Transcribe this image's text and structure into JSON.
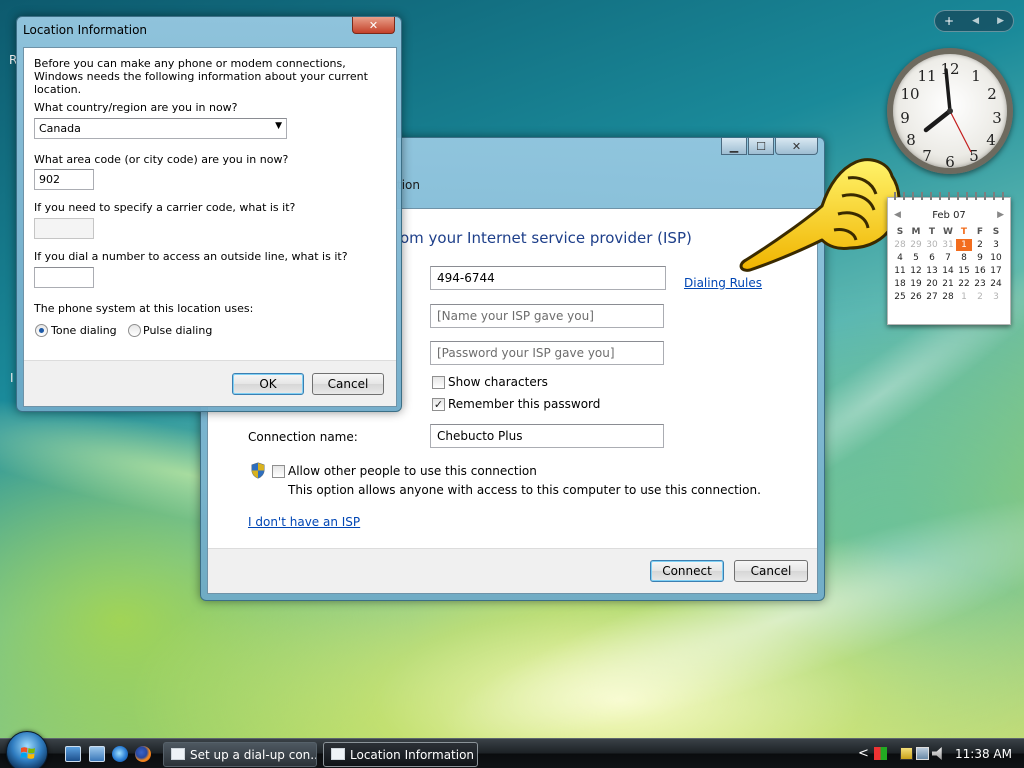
{
  "desktop": {
    "left_letters": [
      "R",
      "I"
    ]
  },
  "dialup_window": {
    "title": "",
    "title_fragment": "tion",
    "header": "om your Internet service provider (ISP)",
    "phone_number": "494-6744",
    "dialing_rules_link": "Dialing Rules",
    "username_placeholder": "[Name your ISP gave you]",
    "password_placeholder": "[Password your ISP gave you]",
    "show_characters": {
      "label": "Show characters",
      "checked": false
    },
    "remember_password": {
      "label": "Remember this password",
      "checked": true
    },
    "connection_name_label": "Connection name:",
    "connection_name": "Chebucto Plus",
    "allow_others": {
      "label": "Allow other people to use this connection",
      "checked": false
    },
    "allow_others_note": "This option allows anyone with access to this computer to use this connection.",
    "no_isp_link": "I don't have an ISP",
    "connect_button": "Connect",
    "cancel_button": "Cancel"
  },
  "location_dialog": {
    "title": "Location Information",
    "intro": "Before you can make any phone or modem connections, Windows needs the following information about your current location.",
    "country_question": "What country/region are you in now?",
    "country_value": "Canada",
    "area_code_question": "What area code (or city code) are you in now?",
    "area_code_value": "902",
    "carrier_question": "If you need to specify a carrier code, what is it?",
    "carrier_value": "",
    "outside_line_question": "If you dial a number to access an outside line, what is it?",
    "outside_line_value": "",
    "phone_system_label": "The phone system at this location uses:",
    "tone_label": "Tone dialing",
    "pulse_label": "Pulse dialing",
    "selected_dialing": "Tone dialing",
    "ok_button": "OK",
    "cancel_button": "Cancel",
    "close_glyph": "✕"
  },
  "gadgets": {
    "bar_buttons": [
      "+",
      "◀",
      "▶"
    ],
    "clock_numbers": [
      "12",
      "1",
      "2",
      "3",
      "4",
      "5",
      "6",
      "7",
      "8",
      "9",
      "10",
      "11"
    ],
    "calendar": {
      "month_label": "Feb 07",
      "day_headers": [
        "S",
        "M",
        "T",
        "W",
        "T",
        "F",
        "S"
      ],
      "weeks": [
        [
          "28",
          "29",
          "30",
          "31",
          "1",
          "2",
          "3"
        ],
        [
          "4",
          "5",
          "6",
          "7",
          "8",
          "9",
          "10"
        ],
        [
          "11",
          "12",
          "13",
          "14",
          "15",
          "16",
          "17"
        ],
        [
          "18",
          "19",
          "20",
          "21",
          "22",
          "23",
          "24"
        ],
        [
          "25",
          "26",
          "27",
          "28",
          "1",
          "2",
          "3"
        ]
      ],
      "today": "1"
    }
  },
  "taskbar": {
    "buttons": [
      {
        "label": "Set up a dial-up con...",
        "active": false
      },
      {
        "label": "Location Information",
        "active": true
      }
    ],
    "tray_chevron": "<",
    "clock": "11:38 AM"
  },
  "colors": {
    "accent_text": "#1e3f8a",
    "link": "#0046b4",
    "calendar_today": "#f26d1e"
  },
  "icons": [
    "windows-start-orb",
    "show-desktop-icon",
    "switch-windows-icon",
    "ie-icon",
    "firefox-icon",
    "dialup-window-icon",
    "location-window-icon",
    "shield-uac-icon",
    "pointing-hand-cursor",
    "volume-icon",
    "network-icon",
    "power-icon"
  ]
}
